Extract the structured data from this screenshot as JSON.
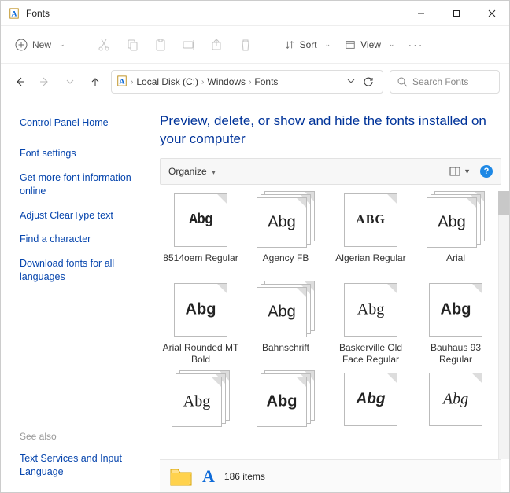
{
  "window": {
    "title": "Fonts"
  },
  "toolbar": {
    "new_label": "New",
    "sort_label": "Sort",
    "view_label": "View"
  },
  "breadcrumbs": {
    "seg1": "Local Disk (C:)",
    "seg2": "Windows",
    "seg3": "Fonts"
  },
  "search": {
    "placeholder": "Search Fonts"
  },
  "sidebar": {
    "home": "Control Panel Home",
    "links": {
      "font_settings": "Font settings",
      "more_info": "Get more font information online",
      "cleartype": "Adjust ClearType text",
      "find_char": "Find a character",
      "download_all": "Download fonts for all languages"
    },
    "see_also_header": "See also",
    "see_also_link": "Text Services and Input Language"
  },
  "page_title": "Preview, delete, or show and hide the fonts installed on your computer",
  "organize": {
    "label": "Organize"
  },
  "help_symbol": "?",
  "fonts": [
    {
      "label": "8514oem Regular",
      "sample": "Abg",
      "font_class": "f-8514",
      "stacked": false
    },
    {
      "label": "Agency FB",
      "sample": "Abg",
      "font_class": "f-agency",
      "stacked": true
    },
    {
      "label": "Algerian Regular",
      "sample": "ABG",
      "font_class": "f-algerian",
      "stacked": false
    },
    {
      "label": "Arial",
      "sample": "Abg",
      "font_class": "f-arial",
      "stacked": true
    },
    {
      "label": "Arial Rounded MT Bold",
      "sample": "Abg",
      "font_class": "f-arialround",
      "stacked": false
    },
    {
      "label": "Bahnschrift",
      "sample": "Abg",
      "font_class": "f-bahn",
      "stacked": true
    },
    {
      "label": "Baskerville Old Face Regular",
      "sample": "Abg",
      "font_class": "f-baskerville",
      "stacked": false
    },
    {
      "label": "Bauhaus 93 Regular",
      "sample": "Abg",
      "font_class": "f-bauhaus",
      "stacked": false
    },
    {
      "label": "",
      "sample": "Abg",
      "font_class": "f-bell",
      "stacked": true
    },
    {
      "label": "",
      "sample": "Abg",
      "font_class": "f-berlin",
      "stacked": true
    },
    {
      "label": "",
      "sample": "Abg",
      "font_class": "f-bernard",
      "stacked": false
    },
    {
      "label": "",
      "sample": "Abg",
      "font_class": "f-blackadder",
      "stacked": false
    }
  ],
  "status": {
    "item_count": "186 items"
  }
}
